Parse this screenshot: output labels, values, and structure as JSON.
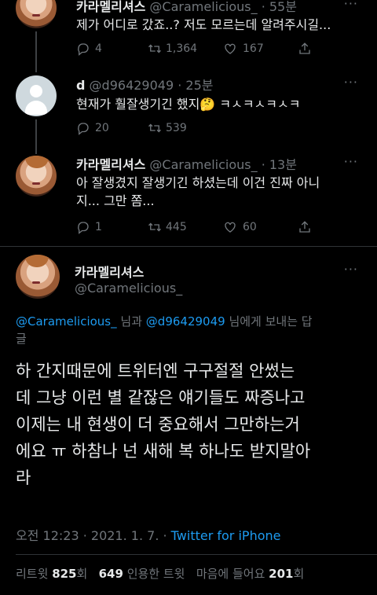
{
  "tweets": [
    {
      "name": "카라멜리셔스",
      "handle": "@Caramelicious_",
      "time": "55분",
      "text": "제가 어디로 갔죠..? 저도 모르는데 알려주시길...",
      "replies": "4",
      "retweets": "1,364",
      "likes": "167",
      "avatar": "profile-photo"
    },
    {
      "name": "d",
      "handle": "@d96429049",
      "time": "25분",
      "text": "현재가 훨잘생기긴 했지🤔 ㅋㅅㅋㅅㅋㅅㅋ",
      "replies": "20",
      "retweets": "539",
      "likes": "",
      "avatar": "default-avatar"
    },
    {
      "name": "카라멜리셔스",
      "handle": "@Caramelicious_",
      "time": "13분",
      "text_line1": "아 잘생겼지 잘생기긴 하셨는데 이건 진짜 아니",
      "text_line2": "지... 그만 쫌...",
      "replies": "1",
      "retweets": "445",
      "likes": "60",
      "avatar": "profile-photo"
    }
  ],
  "main_tweet": {
    "name": "카라멜리셔스",
    "handle": "@Caramelicious_",
    "reply_to": {
      "mention1": "@Caramelicious_",
      "connector": "님과",
      "mention2": "@d96429049",
      "suffix_line1": "님에게 보내는 답",
      "suffix_line2": "글"
    },
    "text_lines": [
      "하 간지때문에 트위터엔 구구절절 안썼는",
      "데 그냥 이런 별 같잖은 얘기들도 짜증나고",
      "이제는 내 현생이 더 중요해서 그만하는거",
      "에요 ㅠ 하참나 넌 새해 복 하나도 받지말아",
      "라"
    ],
    "timestamp": "오전 12:23 · 2021. 1. 7. · ",
    "source": "Twitter for iPhone",
    "stats": {
      "retweets_label": "리트윗",
      "retweets": "825",
      "retweets_unit": "회",
      "quotes": "649",
      "quotes_label": "인용한 트윗",
      "likes_label": "마음에 들어요",
      "likes": "201",
      "likes_unit": "회"
    }
  },
  "more_glyph": "···",
  "colors": {
    "background": "#000000",
    "text": "#e7e9ea",
    "secondary": "#71767b",
    "link": "#1d9bf0",
    "divider": "#2f3336"
  }
}
